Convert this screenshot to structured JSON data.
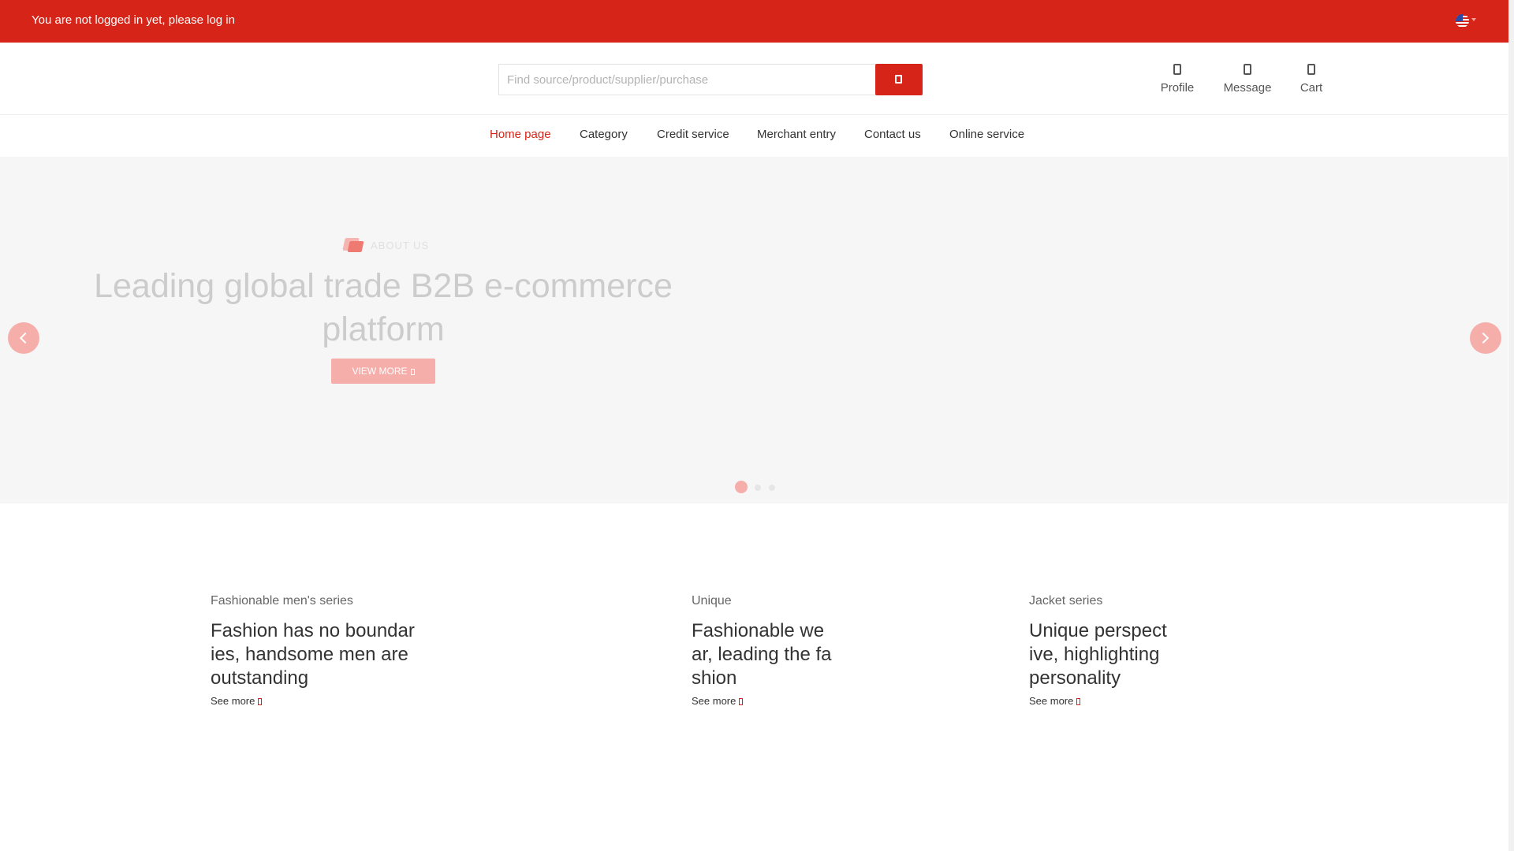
{
  "topbar": {
    "login_text": "You are not logged in yet, please log in",
    "language_icon": "us-flag-icon"
  },
  "search": {
    "placeholder": "Find source/product/supplier/purchase",
    "button_icon": "search-icon"
  },
  "quick_links": [
    {
      "label": "Profile",
      "icon": "user-icon"
    },
    {
      "label": "Message",
      "icon": "message-icon"
    },
    {
      "label": "Cart",
      "icon": "cart-icon"
    }
  ],
  "nav": {
    "items": [
      "Home page",
      "Category",
      "Credit service",
      "Merchant entry",
      "Contact us",
      "Online service"
    ],
    "active": "Home page"
  },
  "hero": {
    "tag": "ABOUT US",
    "headline": "Leading global trade B2B e-commerce platform",
    "button": "VIEW MORE",
    "slide_count": 3,
    "active_slide": 1
  },
  "promos": [
    {
      "subtitle": "Fashionable men's series",
      "title": "Fashion has no boundaries, handsome men are outstanding",
      "link": "See more"
    },
    {
      "subtitle": "Unique",
      "title": "Fashionable wear, leading the fashion",
      "link": "See more"
    },
    {
      "subtitle": "Jacket series",
      "title": "Unique perspective, highlighting personality",
      "link": "See more"
    }
  ],
  "colors": {
    "brand": "#d72418",
    "brand_light": "#f5aeaa",
    "hero_bg": "#f6f6f6"
  }
}
